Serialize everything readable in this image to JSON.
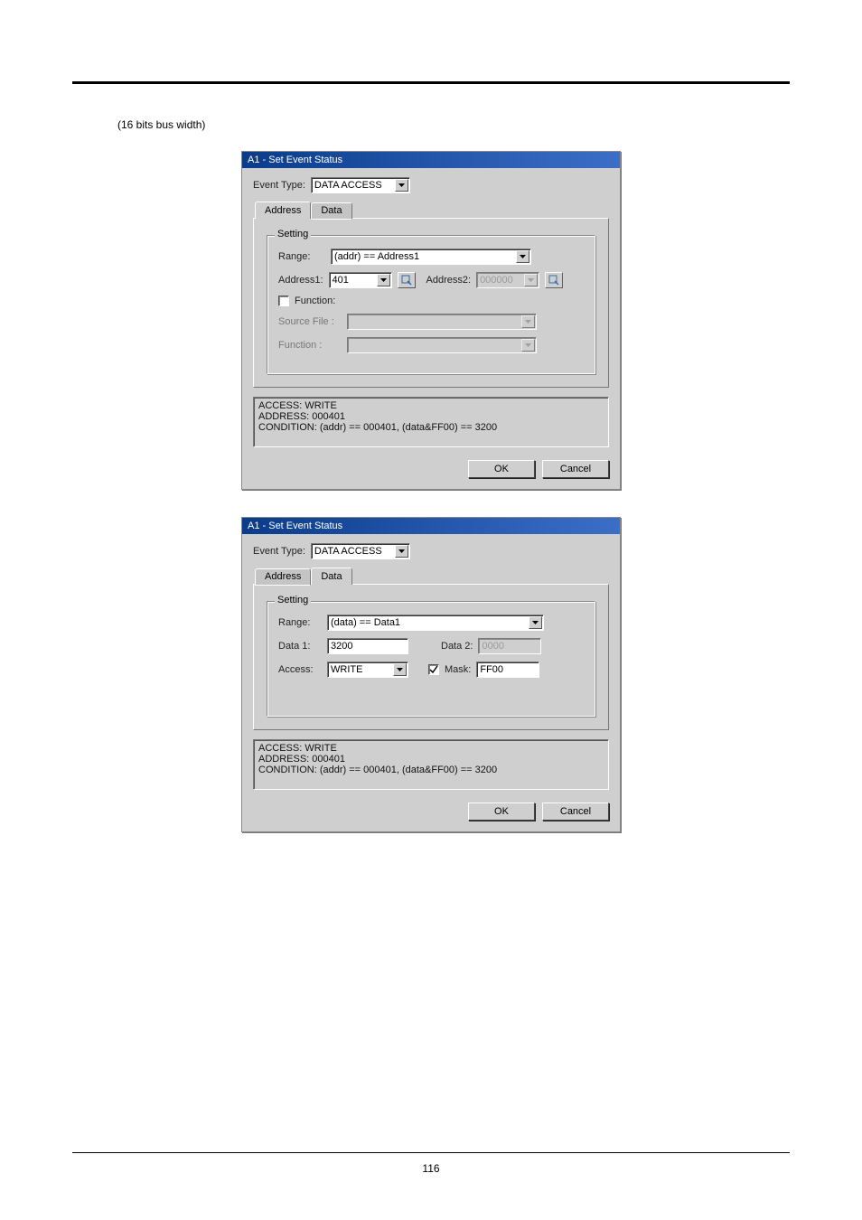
{
  "caption": "(16 bits bus width)",
  "dialog_title": "A1 - Set Event Status",
  "event_type_label": "Event Type:",
  "event_type_value": "DATA ACCESS",
  "tabs": {
    "address": "Address",
    "data": "Data"
  },
  "group_label": "Setting",
  "d1": {
    "active_tab": "address",
    "range_label": "Range:",
    "range_value": "(addr) == Address1",
    "address1_label": "Address1:",
    "address1_value": "401",
    "address2_label": "Address2:",
    "address2_value": "000000",
    "function_check_label": "Function:",
    "source_file_label": "Source File :",
    "function_label": "Function :",
    "info_line1": "ACCESS: WRITE",
    "info_line2": "ADDRESS: 000401",
    "info_line3": "CONDITION: (addr) == 000401, (data&FF00) == 3200"
  },
  "d2": {
    "active_tab": "data",
    "range_label": "Range:",
    "range_value": "(data) == Data1",
    "data1_label": "Data 1:",
    "data1_value": "3200",
    "data2_label": "Data 2:",
    "data2_value": "0000",
    "access_label": "Access:",
    "access_value": "WRITE",
    "mask_label": "Mask:",
    "mask_value": "FF00",
    "info_line1": "ACCESS: WRITE",
    "info_line2": "ADDRESS: 000401",
    "info_line3": "CONDITION: (addr) == 000401, (data&FF00) == 3200"
  },
  "buttons": {
    "ok": "OK",
    "cancel": "Cancel"
  },
  "page_number": "116"
}
